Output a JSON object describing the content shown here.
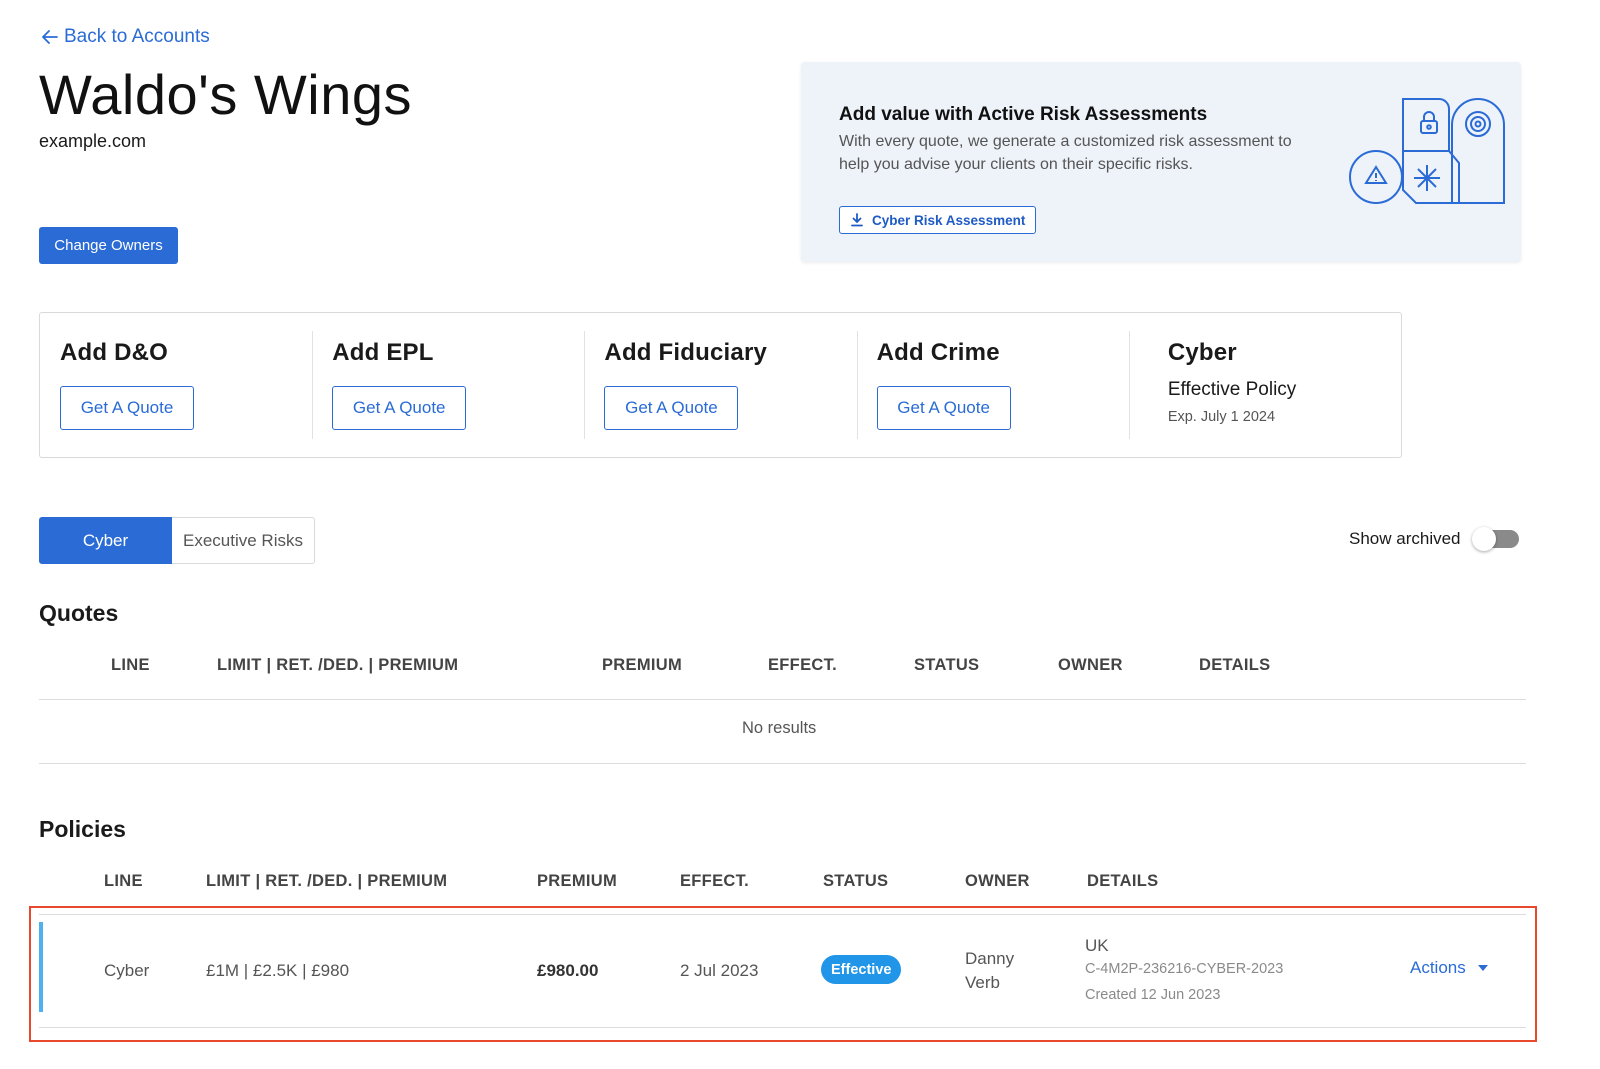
{
  "nav": {
    "back_label": "Back to Accounts"
  },
  "account": {
    "name": "Waldo's Wings",
    "domain": "example.com",
    "change_owners_label": "Change Owners"
  },
  "promo": {
    "title": "Add value with Active Risk Assessments",
    "text": "With every quote, we generate a customized risk assessment to help you advise your clients on their specific risks.",
    "button_label": "Cyber Risk Assessment"
  },
  "products": [
    {
      "title": "Add D&O",
      "button_label": "Get A Quote"
    },
    {
      "title": "Add EPL",
      "button_label": "Get A Quote"
    },
    {
      "title": "Add Fiduciary",
      "button_label": "Get A Quote"
    },
    {
      "title": "Add Crime",
      "button_label": "Get A Quote"
    },
    {
      "title": "Cyber",
      "subtitle": "Effective Policy",
      "expiry": "Exp. July 1 2024"
    }
  ],
  "tabs": [
    {
      "label": "Cyber",
      "active": true
    },
    {
      "label": "Executive Risks",
      "active": false
    }
  ],
  "show_archived": {
    "label": "Show archived",
    "enabled": false
  },
  "quotes": {
    "title": "Quotes",
    "columns": [
      "LINE",
      "LIMIT | RET. /DED. | PREMIUM",
      "PREMIUM",
      "EFFECT.",
      "STATUS",
      "OWNER",
      "DETAILS"
    ],
    "empty_text": "No results"
  },
  "policies": {
    "title": "Policies",
    "columns": [
      "LINE",
      "LIMIT | RET. /DED. | PREMIUM",
      "PREMIUM",
      "EFFECT.",
      "STATUS",
      "OWNER",
      "DETAILS"
    ],
    "rows": [
      {
        "line": "Cyber",
        "limits": "£1M | £2.5K | £980",
        "premium": "£980.00",
        "effective": "2 Jul 2023",
        "status": "Effective",
        "owner_first": "Danny",
        "owner_last": "Verb",
        "country": "UK",
        "policy_id": "C-4M2P-236216-CYBER-2023",
        "created": "Created 12 Jun 2023",
        "actions_label": "Actions"
      }
    ]
  },
  "colors": {
    "accent": "#2a6bd6",
    "status_effective": "#2196e8",
    "row_accent": "#4db2ee",
    "highlight": "#e8492c"
  }
}
